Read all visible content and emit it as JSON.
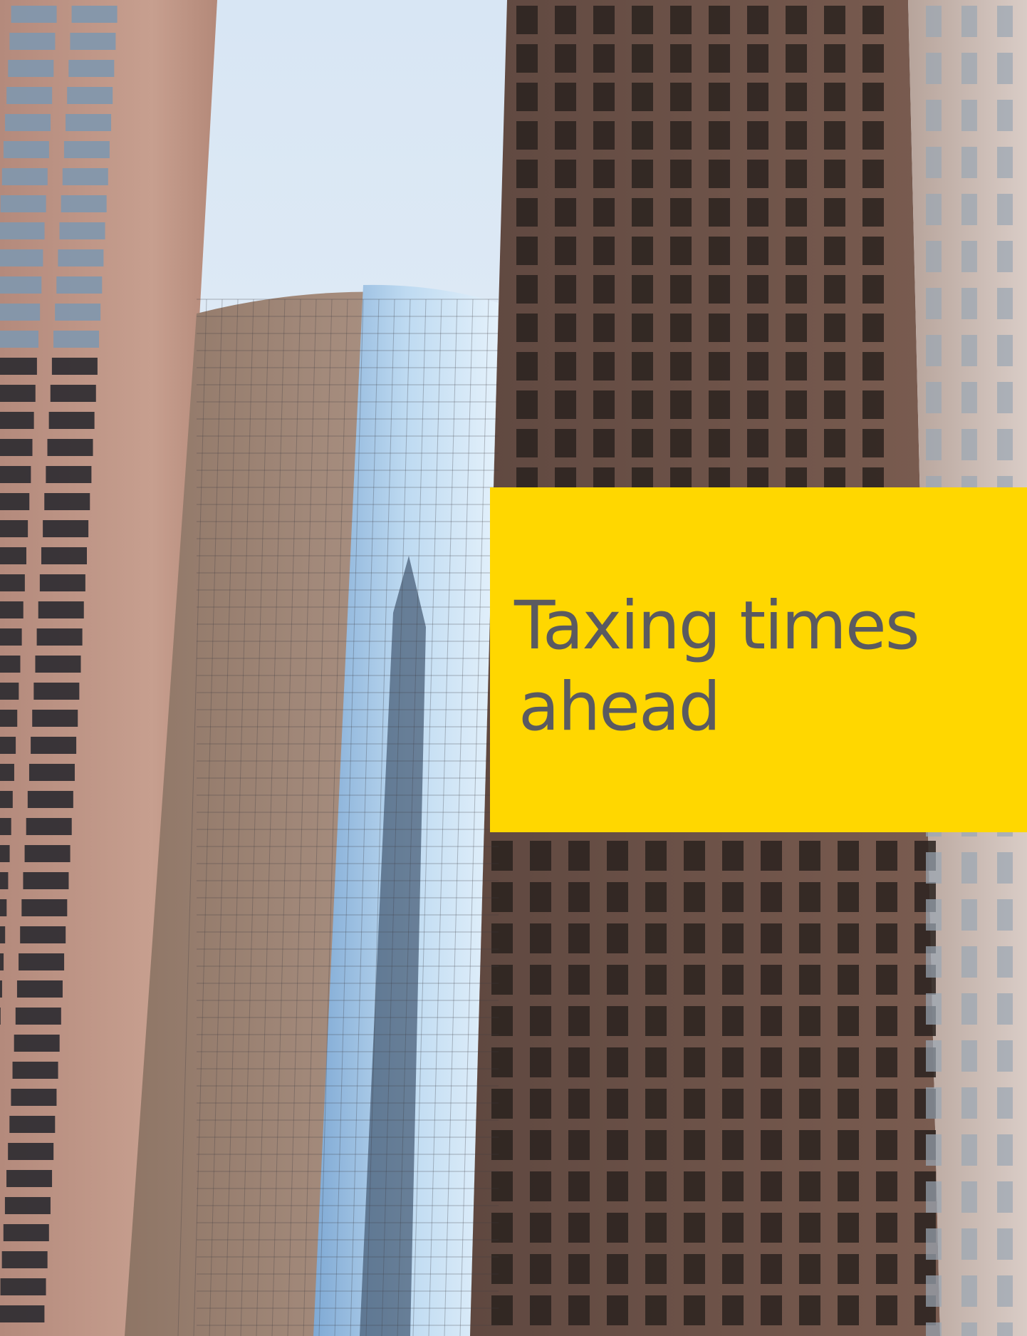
{
  "cover": {
    "title_lines": [
      "Taxing times",
      "ahead"
    ]
  },
  "colors": {
    "panel_background": "#FFD700",
    "title_text": "#5A5A60",
    "sky": "#D8E6F4"
  },
  "photo": {
    "subject": "city-skyscrapers-photo"
  }
}
